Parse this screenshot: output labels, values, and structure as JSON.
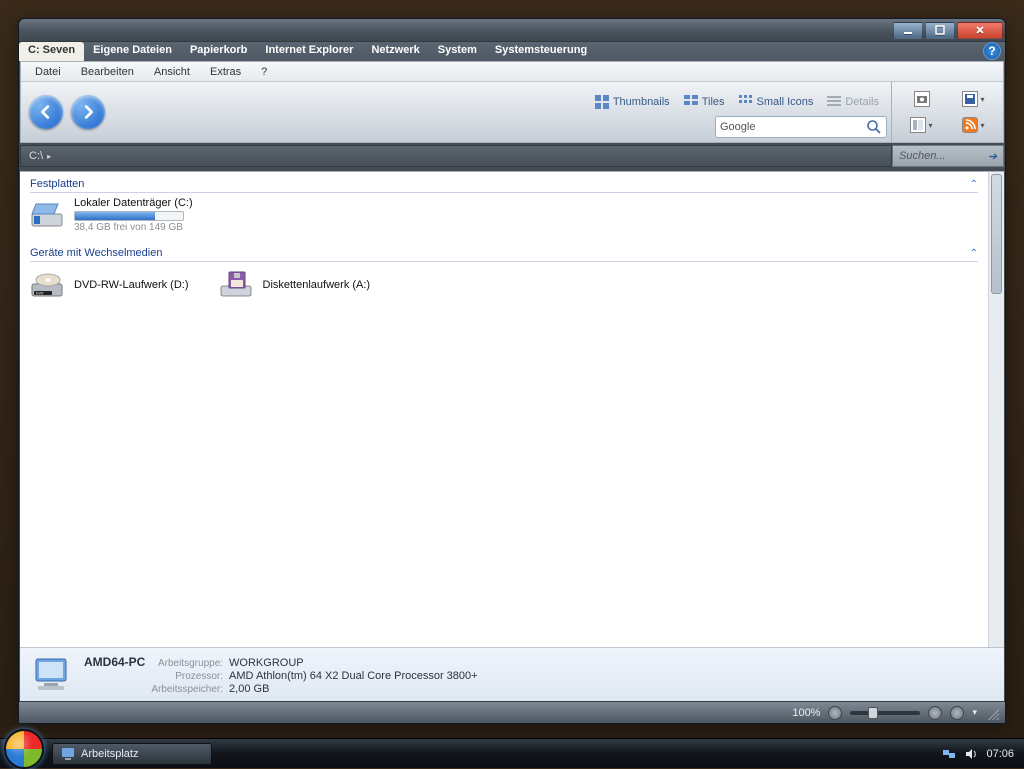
{
  "tabs": [
    "C: Seven",
    "Eigene Dateien",
    "Papierkorb",
    "Internet Explorer",
    "Netzwerk",
    "System",
    "Systemsteuerung"
  ],
  "active_tab_index": 0,
  "menu": {
    "datei": "Datei",
    "bearbeiten": "Bearbeiten",
    "ansicht": "Ansicht",
    "extras": "Extras",
    "help": "?"
  },
  "view_buttons": {
    "thumbnails": "Thumbnails",
    "tiles": "Tiles",
    "small_icons": "Small Icons",
    "details": "Details"
  },
  "search": {
    "value": "Google"
  },
  "address": {
    "path": "C:\\"
  },
  "search_right": {
    "placeholder": "Suchen..."
  },
  "groups": {
    "hdd_header": "Festplatten",
    "removable_header": "Geräte mit Wechselmedien"
  },
  "drives": {
    "c": {
      "name": "Lokaler Datenträger (C:)",
      "subtitle": "38,4 GB frei von 149 GB",
      "fill_percent": 74
    },
    "d": {
      "name": "DVD-RW-Laufwerk (D:)"
    },
    "a": {
      "name": "Diskettenlaufwerk (A:)"
    }
  },
  "details_pane": {
    "computer_name": "AMD64-PC",
    "workgroup_key": "Arbeitsgruppe:",
    "workgroup_val": "WORKGROUP",
    "cpu_key": "Prozessor:",
    "cpu_val": "AMD Athlon(tm) 64 X2 Dual Core Processor 3800+",
    "ram_key": "Arbeitsspeicher:",
    "ram_val": "2,00 GB"
  },
  "status": {
    "zoom": "100%"
  },
  "taskbar": {
    "button": "Arbeitsplatz",
    "clock": "07:06"
  }
}
